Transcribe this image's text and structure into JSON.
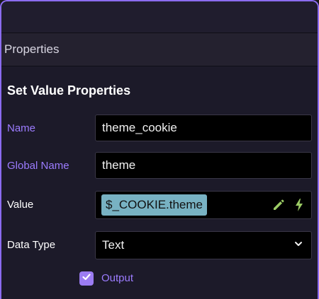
{
  "section": {
    "title": "Properties"
  },
  "form": {
    "heading": "Set Value Properties",
    "name": {
      "label": "Name",
      "value": "theme_cookie"
    },
    "global_name": {
      "label": "Global Name",
      "value": "theme"
    },
    "value": {
      "label": "Value",
      "chip": "$_COOKIE.theme"
    },
    "data_type": {
      "label": "Data Type",
      "value": "Text"
    },
    "output": {
      "label": "Output",
      "checked": true
    }
  },
  "icons": {
    "edit": "pencil-icon",
    "dynamic": "lightning-icon",
    "dropdown": "chevron-down-icon",
    "checkbox": "checkmark-icon"
  },
  "colors": {
    "accent": "#8b6cf0",
    "chip_bg": "#78b2c3",
    "icon_green": "#9ccc65",
    "label_purple": "#9c7cff"
  }
}
